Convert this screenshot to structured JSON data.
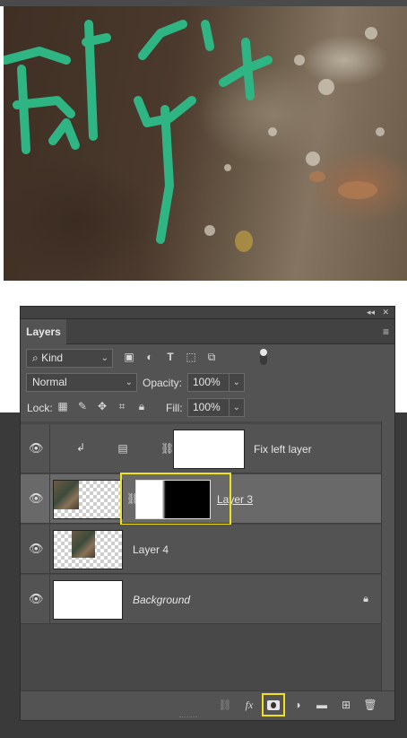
{
  "panel": {
    "title": "Layers",
    "collapse_icon": "double-chevron-right-icon",
    "close_icon": "close-icon",
    "menu_icon": "hamburger-menu-icon"
  },
  "filter": {
    "kind_label": "Kind",
    "icons": [
      "pixel-filter-icon",
      "adjustment-filter-icon",
      "type-filter-icon",
      "shape-filter-icon",
      "smart-object-filter-icon"
    ]
  },
  "blend": {
    "mode": "Normal",
    "opacity_label": "Opacity:",
    "opacity_value": "100%",
    "lock_label": "Lock:",
    "fill_label": "Fill:",
    "fill_value": "100%"
  },
  "layers": [
    {
      "name": "Fix left layer",
      "type": "adjustment-clipped",
      "visible": true,
      "selected": false
    },
    {
      "name": "Layer 3",
      "type": "pixel-with-mask",
      "visible": true,
      "selected": true
    },
    {
      "name": "Layer 4",
      "type": "pixel",
      "visible": true,
      "selected": false
    },
    {
      "name": "Background",
      "type": "background",
      "visible": true,
      "selected": false,
      "locked": true
    }
  ],
  "bottom_bar": {
    "icons": [
      "link-layers-icon",
      "fx-icon",
      "add-mask-icon",
      "new-adjustment-icon",
      "new-group-icon",
      "new-layer-icon",
      "trash-icon"
    ],
    "fx_label": "fx"
  },
  "colors": {
    "panel_bg": "#535353",
    "selected_row": "#696969",
    "highlight": "#f2e21a",
    "graffiti": "#2fb583"
  }
}
